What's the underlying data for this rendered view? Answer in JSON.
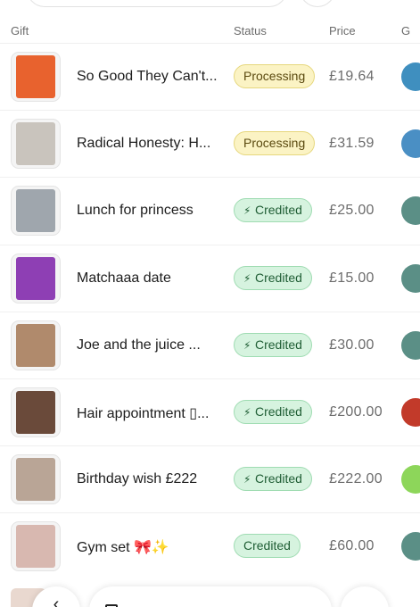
{
  "header": {
    "gift": "Gift",
    "status": "Status",
    "price": "Price",
    "extra": "G"
  },
  "rows": [
    {
      "name": "So Good They Can't...",
      "status": "Processing",
      "status_type": "processing",
      "price": "£19.64",
      "thumb": "book-cover-so-good",
      "thumb_color": "#e8622e",
      "avatar_color": "#3f8fbf"
    },
    {
      "name": "Radical Honesty: H...",
      "status": "Processing",
      "status_type": "processing",
      "price": "£31.59",
      "thumb": "book-cover-radical-honesty",
      "thumb_color": "#c9c4bd",
      "avatar_color": "#4a8fc4"
    },
    {
      "name": "Lunch for princess",
      "status": "Credited",
      "status_type": "credited",
      "price": "£25.00",
      "thumb": "photo-lunch",
      "thumb_color": "#9fa6ad",
      "avatar_color": "#5b8f86"
    },
    {
      "name": "Matchaaa date",
      "status": "Credited",
      "status_type": "credited",
      "price": "£15.00",
      "thumb": "photo-matcha",
      "thumb_color": "#8e3fb4",
      "avatar_color": "#5b8f86"
    },
    {
      "name": "Joe and the juice ...",
      "status": "Credited",
      "status_type": "credited",
      "price": "£30.00",
      "thumb": "photo-juice",
      "thumb_color": "#b08a6c",
      "avatar_color": "#5b8f86"
    },
    {
      "name": "Hair appointment ▯...",
      "status": "Credited",
      "status_type": "credited",
      "price": "£200.00",
      "thumb": "photo-hair",
      "thumb_color": "#6a4a3a",
      "avatar_color": "#c23a2a"
    },
    {
      "name": "Birthday wish £222",
      "status": "Credited",
      "status_type": "credited",
      "price": "£222.00",
      "thumb": "photo-birthday",
      "thumb_color": "#b9a596",
      "avatar_color": "#8dd65a"
    },
    {
      "name": "Gym set 🎀✨",
      "status": "Credited",
      "status_type": "credited",
      "price": "£60.00",
      "thumb": "photo-gym-set",
      "thumb_color": "#d8b8b0",
      "avatar_color": "#5b8f86"
    }
  ],
  "bolt_glyph": "⚡",
  "nav": {
    "back_glyph": "‹",
    "forward_glyph": "→"
  }
}
